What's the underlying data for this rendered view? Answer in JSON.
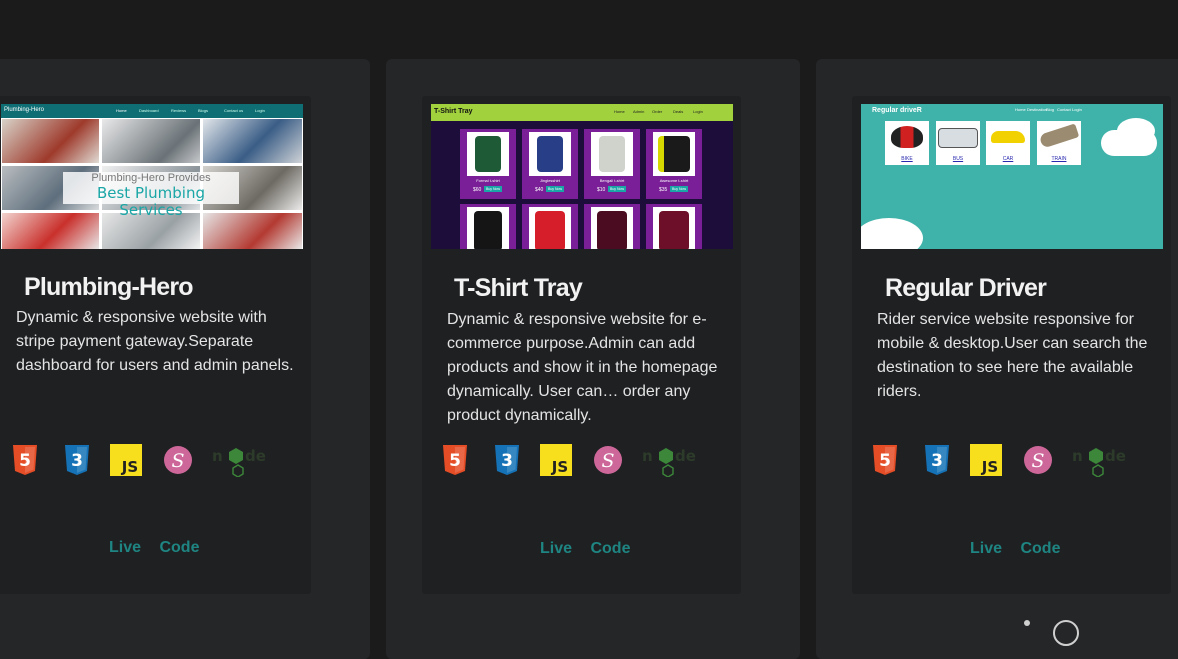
{
  "projects": [
    {
      "title": "Plumbing-Hero",
      "description": "Dynamic & responsive website with stripe payment gateway.Separate dashboard for users and admin panels.",
      "thumb": {
        "brand": "Plumbing-Hero",
        "nav": [
          "Home",
          "Dashboard",
          "Reviews",
          "Blogs",
          "Contact us",
          "Login"
        ],
        "overlay_line1": "Plumbing-Hero Provides",
        "overlay_line2": "Best Plumbing Services"
      },
      "live_label": "Live",
      "code_label": "Code"
    },
    {
      "title": "T-Shirt Tray",
      "description": "Dynamic & responsive website for e-commerce purpose.Admin can add products and show it in the homepage dynamically. User can… order any product dynamically.",
      "thumb": {
        "brand": "T-Shirt Tray",
        "nav": [
          "Home",
          "Admin",
          "Order",
          "Deals",
          "Login"
        ],
        "products": [
          {
            "name": "Formal t-shirt",
            "price": "$60",
            "button": "Buy Now",
            "color": "#1f5a37"
          },
          {
            "name": "Jinglesshirt",
            "price": "$40",
            "button": "Buy Now",
            "color": "#283e86"
          },
          {
            "name": "Bengali t-shirt",
            "price": "$10",
            "button": "Buy Now",
            "color": "#cfd3cc"
          },
          {
            "name": "Awesome t-shirt",
            "price": "$35",
            "button": "Buy Now",
            "color": "#1a1a1a"
          }
        ]
      },
      "live_label": "Live",
      "code_label": "Code"
    },
    {
      "title": "Regular Driver",
      "description": "Rider service website responsive for mobile & desktop.User can search the destination to see here the available riders.",
      "thumb": {
        "brand": "Regular driveR",
        "nav": [
          "Home",
          "Destination",
          "Blog",
          "Contact",
          "Login"
        ],
        "vehicles": [
          "BIKE",
          "BUS",
          "CAR",
          "TRAIN"
        ]
      },
      "live_label": "Live",
      "code_label": "Code"
    }
  ],
  "tech_icons": [
    {
      "name": "html5-icon",
      "text": "5",
      "color": "#e44d26"
    },
    {
      "name": "css3-icon",
      "text": "3",
      "color": "#1572b6"
    },
    {
      "name": "javascript-icon",
      "text": "JS",
      "color": "#f7df1e"
    },
    {
      "name": "sass-icon",
      "text": "S",
      "color": "#cd6799"
    },
    {
      "name": "nodejs-icon",
      "text": "node",
      "color": "#3c873a"
    }
  ]
}
